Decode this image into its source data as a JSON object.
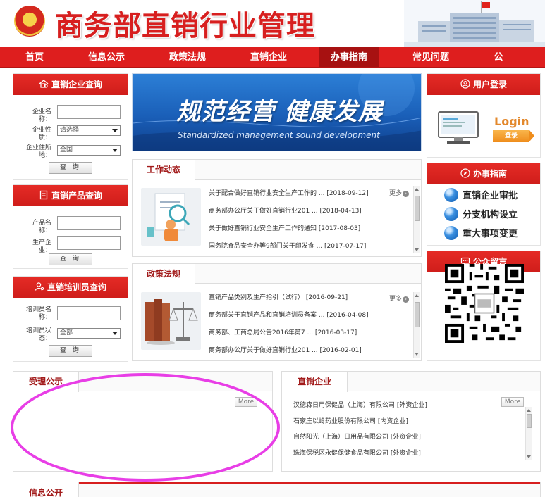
{
  "site": {
    "title": "商务部直销行业管理"
  },
  "nav": [
    "首页",
    "信息公示",
    "政策法规",
    "直销企业",
    "办事指南",
    "常见问题",
    "公"
  ],
  "nav_active": "办事指南",
  "enterprise_query": {
    "title": "直销企业查询",
    "name_label": "企业名称：",
    "type_label": "企业性质：",
    "type_value": "请选择",
    "location_label": "企业住所地：",
    "location_value": "全国",
    "button": "查 询"
  },
  "product_query": {
    "title": "直销产品查询",
    "name_label": "产品名称：",
    "producer_label": "生产企业：",
    "button": "查 询"
  },
  "trainer_query": {
    "title": "直销培训员查询",
    "name_label": "培训员名称：",
    "status_label": "培训员状态：",
    "status_value": "全部",
    "button": "查 询"
  },
  "banner": {
    "cn": "规范经营  健康发展",
    "en": "Standardized management    sound development"
  },
  "work_news": {
    "tab": "工作动态",
    "more": "更多",
    "items": [
      "关于配合做好直销行业安全生产工作的 ... [2018-09-12]",
      "商务部办公厅关于做好直销行业201 ... [2018-04-13]",
      "关于做好直销行业安全生产工作的通知 [2017-08-03]",
      "国务院食品安全办等9部门关于印发食 ... [2017-07-17]"
    ]
  },
  "policy_news": {
    "tab": "政策法规",
    "more": "更多",
    "items": [
      "直销产品类别及生产指引（试行） [2016-09-21]",
      "商务部关于直销产品和直销培训员备案 ... [2016-04-08]",
      "商务部、工商总局公告2016年第7 ... [2016-03-17]",
      "商务部办公厅关于做好直销行业201 ... [2016-02-01]"
    ]
  },
  "login": {
    "title": "用户登录",
    "login_text": "Login",
    "button": "登录"
  },
  "guide": {
    "title": "办事指南",
    "items": [
      "直销企业审批",
      "分支机构设立",
      "重大事项变更"
    ]
  },
  "message": {
    "title": "公众留言"
  },
  "acceptance": {
    "tab": "受理公示",
    "more": "More"
  },
  "companies": {
    "tab": "直销企业",
    "more": "More",
    "items": [
      "汉德森日用保健品（上海）有限公司 [外资企业]",
      "石家庄以岭药业股份有限公司 [内资企业]",
      "自然阳光（上海）日用品有限公司 [外资企业]",
      "珠海保税区永健保健食品有限公司 [外资企业]"
    ]
  },
  "info_open": {
    "tab": "信息公开"
  },
  "colors": {
    "brand_red": "#de1e1e",
    "annotation": "#e83ee6"
  }
}
